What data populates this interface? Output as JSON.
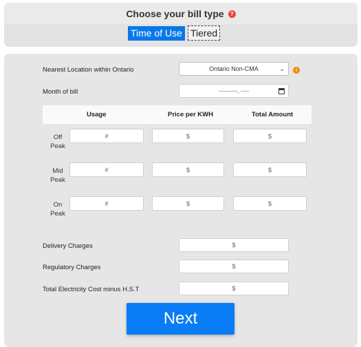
{
  "header": {
    "title": "Choose your bill type",
    "help_icon": "?",
    "options": [
      "Time of Use",
      "Tiered"
    ],
    "selected": "Time of Use"
  },
  "form": {
    "location_label": "Nearest Location within Ontario",
    "location_value": "Ontario Non-CMA",
    "info_icon": "i",
    "month_label": "Month of bill",
    "month_placeholder": "---------, ----",
    "table": {
      "headers": [
        "Usage",
        "Price per KWH",
        "Total Amount"
      ],
      "rows": [
        {
          "label": "Off Peak",
          "usage": "#",
          "price": "$",
          "total": "$"
        },
        {
          "label": "Mid Peak",
          "usage": "#",
          "price": "$",
          "total": "$"
        },
        {
          "label": "On Peak",
          "usage": "#",
          "price": "$",
          "total": "$"
        }
      ]
    },
    "delivery_label": "Delivery Charges",
    "delivery_placeholder": "$",
    "regulatory_label": "Regulatory Charges",
    "regulatory_placeholder": "$",
    "total_label": "Total Electricity Cost minus H.S.T",
    "total_placeholder": "$",
    "next_label": "Next"
  },
  "colors": {
    "primary": "#0a79e8",
    "help_icon": "#e8433a",
    "info_icon": "#f28a00"
  }
}
